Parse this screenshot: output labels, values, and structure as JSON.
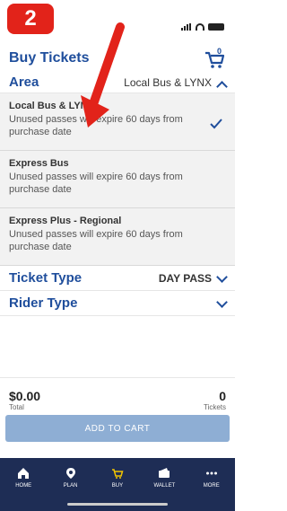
{
  "step": "2",
  "header": {
    "title": "Buy Tickets",
    "cart_count": "0"
  },
  "area": {
    "label": "Area",
    "selected": "Local Bus & LYNX",
    "options": [
      {
        "name": "Local Bus & LYNX",
        "desc": "Unused passes will expire 60 days from purchase date",
        "selected": true
      },
      {
        "name": "Express Bus",
        "desc": "Unused passes will expire 60 days from purchase date",
        "selected": false
      },
      {
        "name": "Express Plus - Regional",
        "desc": "Unused passes will expire 60 days from purchase date",
        "selected": false
      }
    ]
  },
  "ticket_type": {
    "label": "Ticket Type",
    "value": "DAY PASS"
  },
  "rider_type": {
    "label": "Rider Type",
    "value": ""
  },
  "totals": {
    "amount": "$0.00",
    "amount_label": "Total",
    "tickets": "0",
    "tickets_label": "Tickets"
  },
  "add_to_cart": "ADD TO CART",
  "nav": [
    {
      "label": "HOME",
      "icon": "home-icon"
    },
    {
      "label": "PLAN",
      "icon": "map-pin-icon"
    },
    {
      "label": "BUY",
      "icon": "cart-icon"
    },
    {
      "label": "WALLET",
      "icon": "wallet-icon"
    },
    {
      "label": "MORE",
      "icon": "more-icon"
    }
  ],
  "colors": {
    "brand": "#1f4e9c",
    "nav": "#1e2d55",
    "accent": "#e2231a",
    "button": "#8eaed4"
  }
}
